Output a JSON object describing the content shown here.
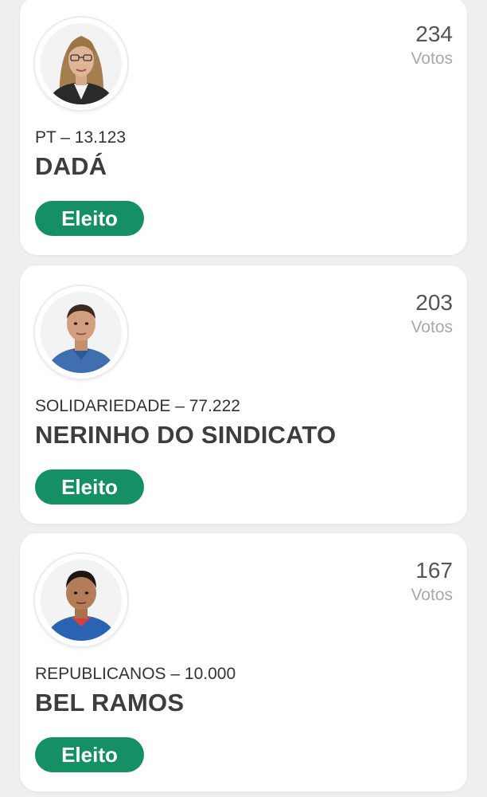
{
  "colors": {
    "page_background": "#efefef",
    "card_background": "#ffffff",
    "status_badge": "#149064",
    "votes_number": "#555555",
    "votes_label": "#a9a9a9"
  },
  "candidates": [
    {
      "party_line": "PT – 13.123",
      "name": "DADÁ",
      "votes": "234",
      "votes_label": "Votos",
      "status": "Eleito",
      "avatar": "candidate-photo-woman"
    },
    {
      "party_line": "SOLIDARIEDADE – 77.222",
      "name": "NERINHO DO SINDICATO",
      "votes": "203",
      "votes_label": "Votos",
      "status": "Eleito",
      "avatar": "candidate-photo-man"
    },
    {
      "party_line": "REPUBLICANOS – 10.000",
      "name": "BEL RAMOS",
      "votes": "167",
      "votes_label": "Votos",
      "status": "Eleito",
      "avatar": "candidate-photo-man"
    }
  ]
}
